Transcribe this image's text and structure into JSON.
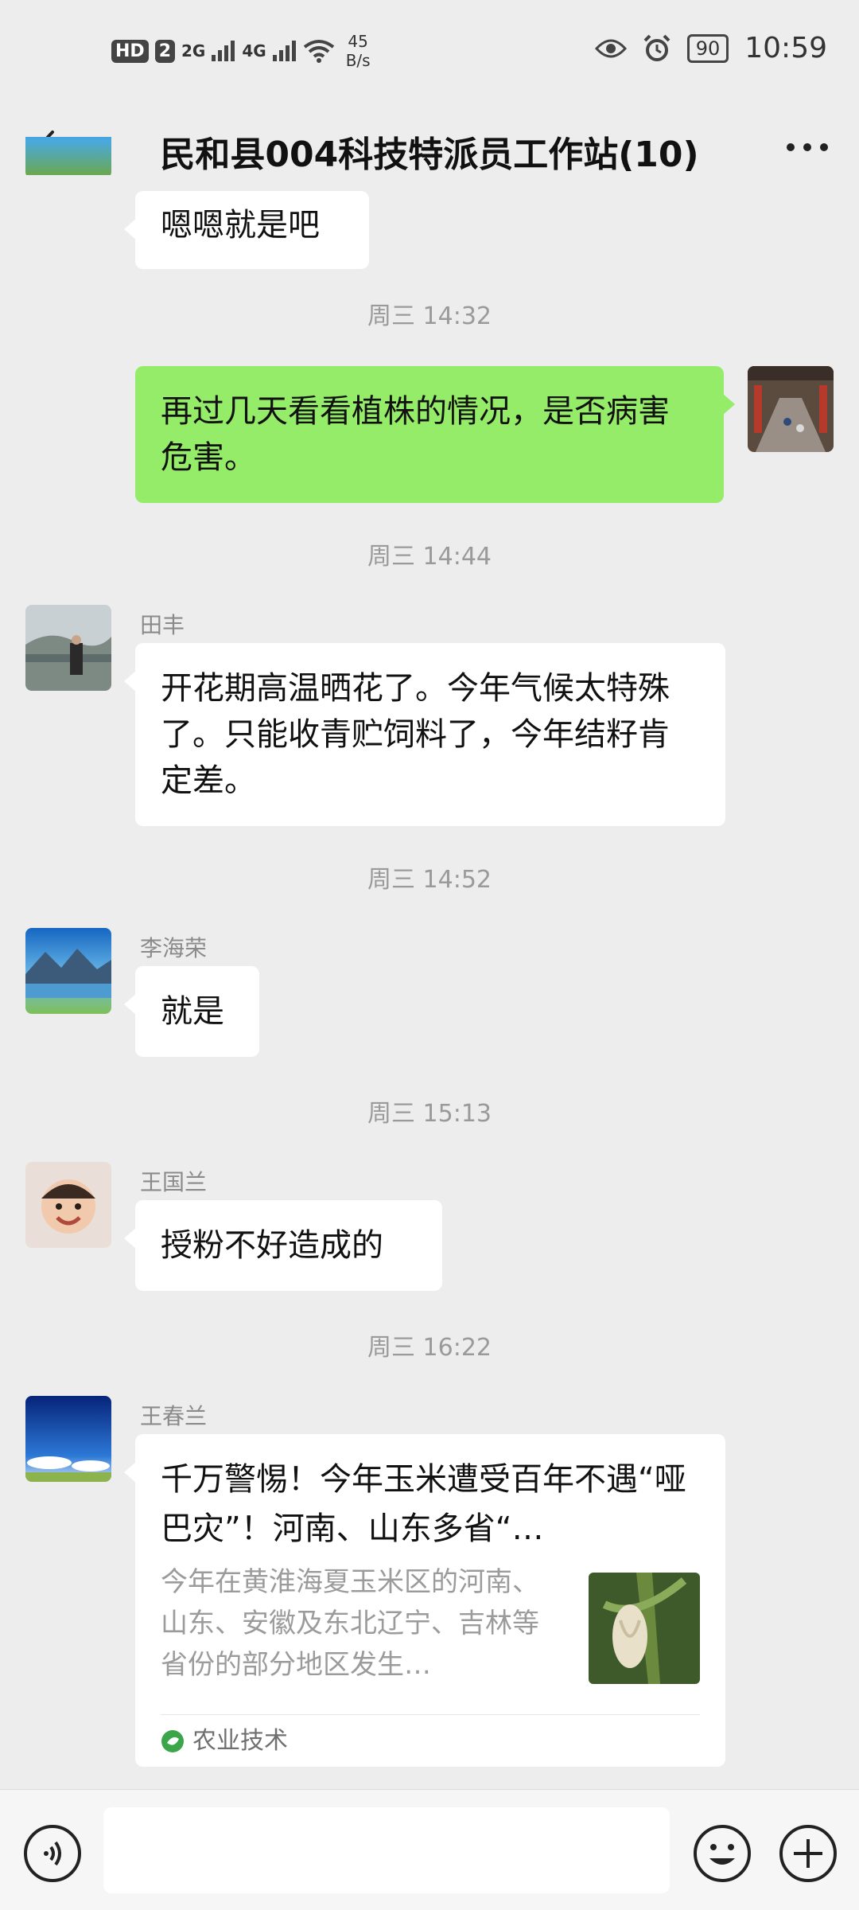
{
  "status_bar": {
    "hd": "HD",
    "sim": "2",
    "net1": "2G",
    "net2": "4G",
    "speed_value": "45",
    "speed_unit": "B/s",
    "battery": "90",
    "time": "10:59"
  },
  "nav": {
    "title": "民和县004科技特派员工作站(10)"
  },
  "messages": {
    "m0_text": "嗯嗯就是吧",
    "t1": "周三 14:32",
    "m1_text": "再过几天看看植株的情况，是否病害危害。",
    "t2": "周三 14:44",
    "m2_sender": "田丰",
    "m2_text": "开花期高温晒花了。今年气候太特殊了。只能收青贮饲料了，今年结籽肯定差。",
    "t3": "周三 14:52",
    "m3_sender": "李海荣",
    "m3_text": "就是",
    "t4": "周三 15:13",
    "m4_sender": "王国兰",
    "m4_text": "授粉不好造成的",
    "t5": "周三 16:22",
    "m5_sender": "王春兰",
    "m5_card_title": "千万警惕！今年玉米遭受百年不遇“哑巴灾”！河南、山东多省“…",
    "m5_card_desc": "今年在黄淮海夏玉米区的河南、山东、安徽及东北辽宁、吉林等省份的部分地区发生…",
    "m5_card_source": "农业技术"
  },
  "input": {
    "placeholder": ""
  },
  "icons": {
    "back": "chevron-left-icon",
    "more": "more-icon",
    "voice": "voice-icon",
    "emoji": "emoji-icon",
    "plus": "plus-icon"
  },
  "colors": {
    "background": "#ededed",
    "outgoing_bubble": "#95ec69",
    "incoming_bubble": "#ffffff",
    "timestamp": "#9a9a9a"
  }
}
